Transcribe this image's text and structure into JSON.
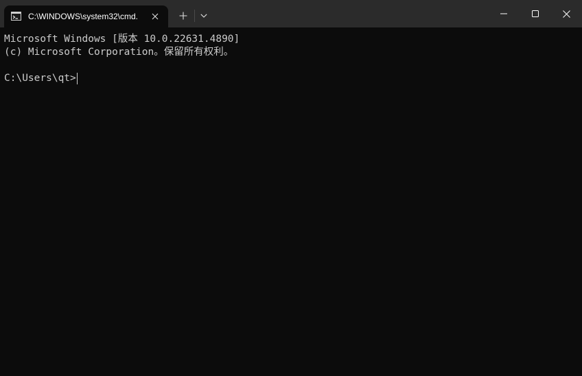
{
  "tab": {
    "title": "C:\\WINDOWS\\system32\\cmd.",
    "icon": "cmd-icon"
  },
  "titlebar": {
    "new_tab_icon": "plus-icon",
    "dropdown_icon": "chevron-down-icon",
    "minimize_icon": "minimize-icon",
    "maximize_icon": "maximize-icon",
    "close_icon": "close-icon"
  },
  "terminal": {
    "lines": [
      "Microsoft Windows [版本 10.0.22631.4890]",
      "(c) Microsoft Corporation。保留所有权利。",
      ""
    ],
    "prompt": "C:\\Users\\qt>",
    "input": ""
  },
  "colors": {
    "background": "#0c0c0c",
    "titlebar": "#2b2b2b",
    "text": "#cccccc"
  }
}
